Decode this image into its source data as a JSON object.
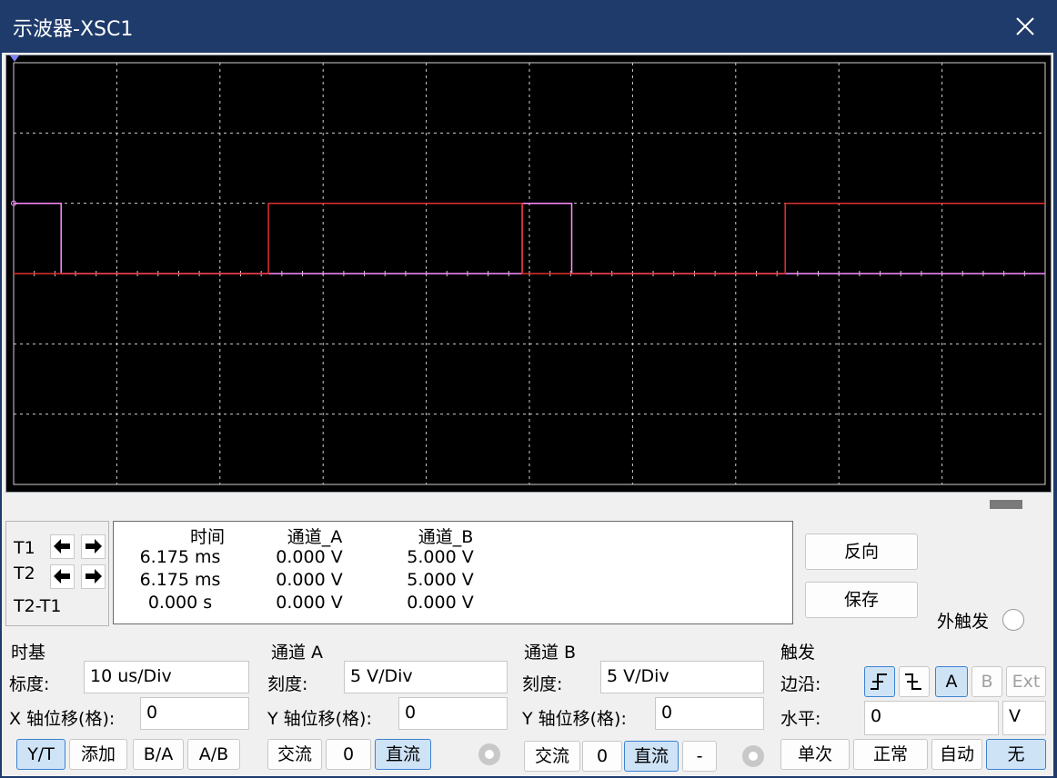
{
  "window": {
    "title": "示波器-XSC1"
  },
  "colors": {
    "titlebar": "#1f3b6b",
    "grid": "#d0d0d0",
    "trace_a": "#ff8cff",
    "trace_b": "#e03030",
    "screen": "#000000",
    "active_button": "#cfe3f7"
  },
  "chart_data": {
    "type": "line",
    "title": "",
    "grid": {
      "x_divisions": 10,
      "y_divisions": 6
    },
    "timebase": "10 us/Div",
    "x_units": "us",
    "y_units": "V",
    "xlim": [
      0,
      100
    ],
    "ylim": [
      -15,
      15
    ],
    "series": [
      {
        "name": "",
        "color": "#ff8cff",
        "points": [
          [
            0,
            5
          ],
          [
            4.6,
            5
          ],
          [
            4.6,
            0
          ],
          [
            49.3,
            0
          ],
          [
            49.3,
            5
          ],
          [
            54.1,
            5
          ],
          [
            54.1,
            0
          ],
          [
            100,
            0
          ]
        ]
      },
      {
        "name": "",
        "color": "#e03030",
        "points": [
          [
            0,
            0
          ],
          [
            24.7,
            0
          ],
          [
            24.7,
            5
          ],
          [
            49.3,
            5
          ],
          [
            49.3,
            0
          ],
          [
            74.8,
            0
          ],
          [
            74.8,
            5
          ],
          [
            100,
            5
          ]
        ]
      }
    ]
  },
  "cursors": {
    "t1_label": "T1",
    "t2_label": "T2",
    "diff_label": "T2-T1",
    "headers": {
      "time": "时间",
      "channel_a": "通道_A",
      "channel_b": "通道_B"
    },
    "rows": [
      {
        "time": "6.175 ms",
        "a": "0.000 V",
        "b": "5.000 V"
      },
      {
        "time": "6.175 ms",
        "a": "0.000 V",
        "b": "5.000 V"
      },
      {
        "time": "0.000 s",
        "a": "0.000 V",
        "b": "0.000 V"
      }
    ]
  },
  "actions": {
    "reverse": "反向",
    "save": "保存",
    "ext_trigger": "外触发"
  },
  "timebase": {
    "title": "时基",
    "scale_label": "标度:",
    "scale_value": "10 us/Div",
    "xpos_label": "X 轴位移(格):",
    "xpos_value": "0",
    "modes": [
      "Y/T",
      "添加",
      "B/A",
      "A/B"
    ]
  },
  "channel_a": {
    "title": "通道 A",
    "scale_label": "刻度:",
    "scale_value": "5  V/Div",
    "ypos_label": "Y 轴位移(格):",
    "ypos_value": "0",
    "coupling": [
      "交流",
      "0",
      "直流"
    ]
  },
  "channel_b": {
    "title": "通道 B",
    "scale_label": "刻度:",
    "scale_value": "5  V/Div",
    "ypos_label": "Y 轴位移(格):",
    "ypos_value": "0",
    "coupling": [
      "交流",
      "0",
      "直流",
      "-"
    ]
  },
  "trigger": {
    "title": "触发",
    "edge_label": "边沿:",
    "sources": [
      "A",
      "B",
      "Ext"
    ],
    "level_label": "水平:",
    "level_value": "0",
    "level_unit": "V",
    "modes": [
      "单次",
      "正常",
      "自动",
      "无"
    ]
  }
}
